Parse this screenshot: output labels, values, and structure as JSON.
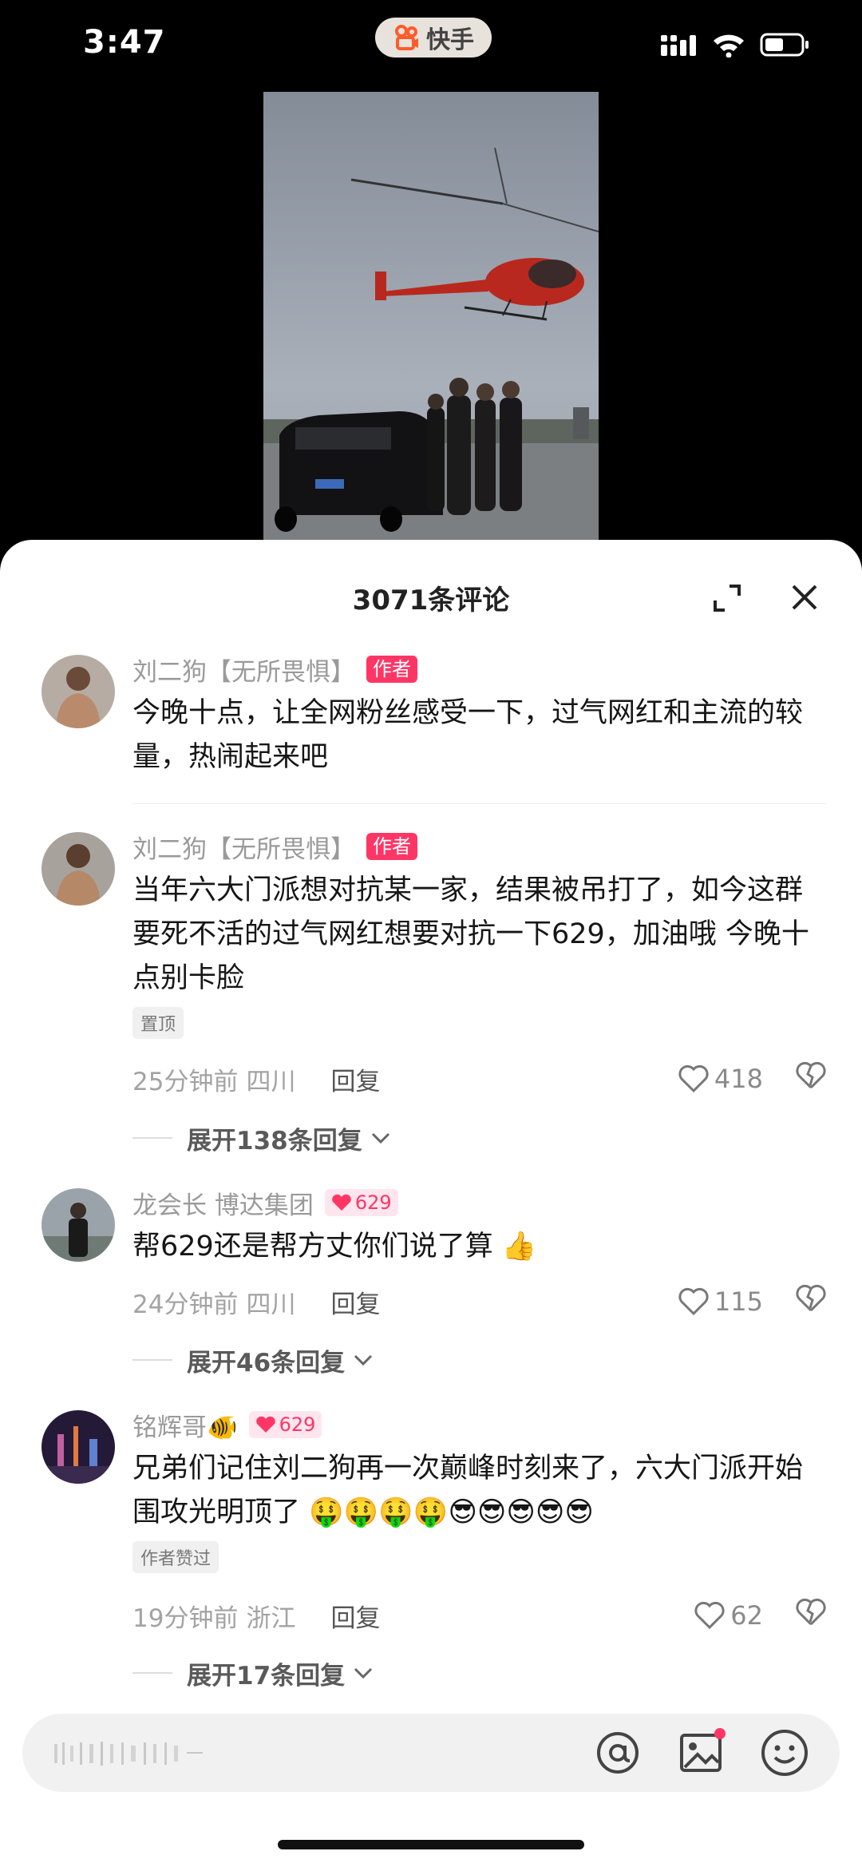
{
  "status_bar": {
    "time": "3:47",
    "app_name": "快手"
  },
  "sheet": {
    "title": "3071条评论"
  },
  "comments": [
    {
      "author": "刘二狗【无所畏惧】",
      "badge": "作者",
      "text": "今晚十点，让全网粉丝感受一下，过气网红和主流的较量，热闹起来吧"
    },
    {
      "author": "刘二狗【无所畏惧】",
      "badge": "作者",
      "text": "当年六大门派想对抗某一家，结果被吊打了，如今这群要死不活的过气网红想要对抗一下629，加油哦 今晚十点别卡脸",
      "tag": "置顶",
      "time": "25分钟前",
      "location": "四川",
      "reply_label": "回复",
      "likes": "418",
      "expand_label": "展开138条回复"
    },
    {
      "author": "龙会长 博达集团",
      "fan_badge": "629",
      "text": "帮629还是帮方丈你们说了算 👍",
      "time": "24分钟前",
      "location": "四川",
      "reply_label": "回复",
      "likes": "115",
      "expand_label": "展开46条回复"
    },
    {
      "author": "铭辉哥🐠",
      "fan_badge": "629",
      "text": "兄弟们记住刘二狗再一次巅峰时刻来了，六大门派开始围攻光明顶了 🤑🤑🤑🤑😎😎😎😎😎",
      "tag": "作者赞过",
      "time": "19分钟前",
      "location": "浙江",
      "reply_label": "回复",
      "likes": "62",
      "expand_label": "展开17条回复"
    }
  ],
  "colors": {
    "accent": "#fe3666",
    "background": "#ffffff"
  }
}
